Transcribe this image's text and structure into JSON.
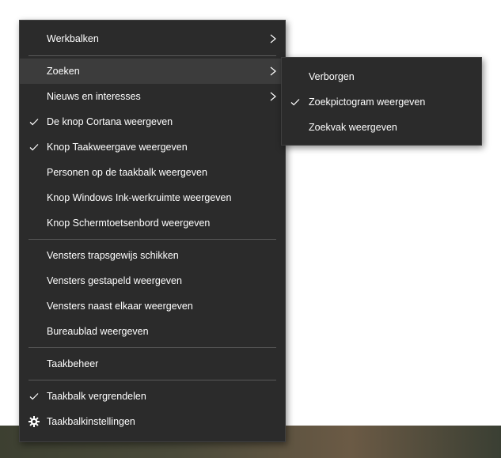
{
  "main_menu": {
    "items": [
      {
        "label": "Werkbalken",
        "submenu": true,
        "checked": false
      },
      {
        "label": "Zoeken",
        "submenu": true,
        "checked": false,
        "highlighted": true
      },
      {
        "label": "Nieuws en interesses",
        "submenu": true,
        "checked": false
      },
      {
        "label": "De knop Cortana weergeven",
        "submenu": false,
        "checked": true
      },
      {
        "label": "Knop Taakweergave weergeven",
        "submenu": false,
        "checked": true
      },
      {
        "label": "Personen op de taakbalk weergeven",
        "submenu": false,
        "checked": false
      },
      {
        "label": "Knop Windows Ink-werkruimte weergeven",
        "submenu": false,
        "checked": false
      },
      {
        "label": "Knop Schermtoetsenbord weergeven",
        "submenu": false,
        "checked": false
      },
      {
        "label": "Vensters trapsgewijs schikken",
        "submenu": false,
        "checked": false
      },
      {
        "label": "Vensters gestapeld weergeven",
        "submenu": false,
        "checked": false
      },
      {
        "label": "Vensters naast elkaar weergeven",
        "submenu": false,
        "checked": false
      },
      {
        "label": "Bureaublad weergeven",
        "submenu": false,
        "checked": false
      },
      {
        "label": "Taakbeheer",
        "submenu": false,
        "checked": false
      },
      {
        "label": "Taakbalk vergrendelen",
        "submenu": false,
        "checked": true
      },
      {
        "label": "Taakbalkinstellingen",
        "submenu": false,
        "checked": false,
        "icon": "gear-icon"
      }
    ]
  },
  "search_submenu": {
    "items": [
      {
        "label": "Verborgen",
        "checked": false
      },
      {
        "label": "Zoekpictogram weergeven",
        "checked": true
      },
      {
        "label": "Zoekvak weergeven",
        "checked": false
      }
    ]
  },
  "colors": {
    "menu_background": "#2b2b2b",
    "hover_background": "#3c3c3c",
    "separator": "#5a5a5a",
    "text": "#ffffff"
  }
}
